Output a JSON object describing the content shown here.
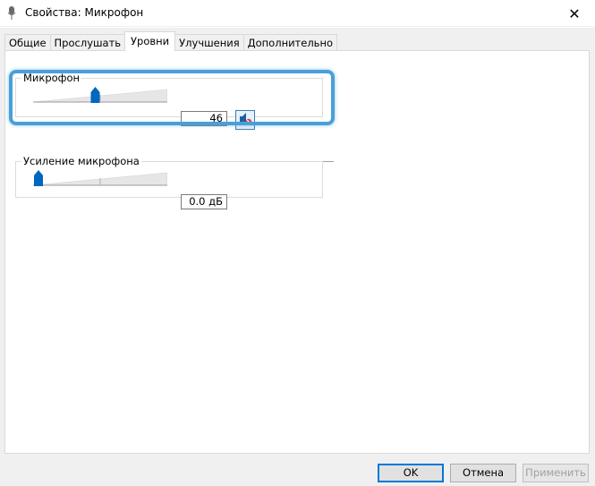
{
  "window": {
    "title": "Свойства: Микрофон",
    "close_glyph": "✕"
  },
  "tabs": [
    {
      "label": "Общие",
      "active": false
    },
    {
      "label": "Прослушать",
      "active": false
    },
    {
      "label": "Уровни",
      "active": true
    },
    {
      "label": "Улучшения",
      "active": false
    },
    {
      "label": "Дополнительно",
      "active": false
    }
  ],
  "levels": {
    "microphone": {
      "label": "Микрофон",
      "value_text": "46",
      "level_fraction": 0.46,
      "muted": true
    },
    "boost": {
      "label": "Усиление микрофона",
      "value_text": "0.0 дБ",
      "level_fraction": 0.0
    }
  },
  "buttons": {
    "ok": "OK",
    "cancel": "Отмена",
    "apply": "Применить"
  },
  "colors": {
    "accent": "#0078d7",
    "highlight": "#4a9fd9",
    "thumb": "#0067c0"
  }
}
